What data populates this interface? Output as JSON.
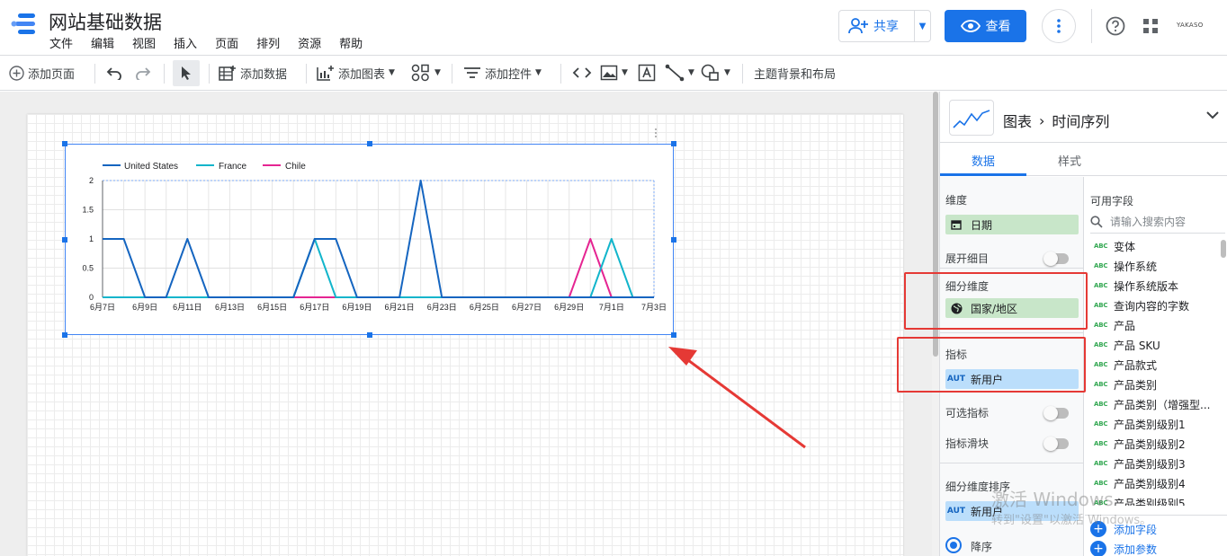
{
  "header": {
    "title": "网站基础数据",
    "menu": [
      "文件",
      "编辑",
      "视图",
      "插入",
      "页面",
      "排列",
      "资源",
      "帮助"
    ],
    "share_label": "共享",
    "view_label": "查看",
    "account_label": "YAKASO"
  },
  "toolbar": {
    "add_page": "添加页面",
    "add_data": "添加数据",
    "add_chart": "添加图表",
    "add_control": "添加控件",
    "theme_layout": "主题背景和布局"
  },
  "chart_data": {
    "type": "line",
    "categories": [
      "6月7日",
      "6月8日",
      "6月9日",
      "6月10日",
      "6月11日",
      "6月12日",
      "6月13日",
      "6月14日",
      "6月15日",
      "6月16日",
      "6月17日",
      "6月18日",
      "6月19日",
      "6月20日",
      "6月21日",
      "6月22日",
      "6月23日",
      "6月24日",
      "6月25日",
      "6月26日",
      "6月27日",
      "6月28日",
      "6月29日",
      "6月30日",
      "7月1日",
      "7月2日",
      "7月3日"
    ],
    "tick_labels": [
      "6月7日",
      "6月9日",
      "6月11日",
      "6月13日",
      "6月15日",
      "6月17日",
      "6月19日",
      "6月21日",
      "6月23日",
      "6月25日",
      "6月27日",
      "6月29日",
      "7月1日",
      "7月3日"
    ],
    "y_ticks": [
      "0",
      "0.5",
      "1",
      "1.5",
      "2"
    ],
    "ylim": [
      0,
      2
    ],
    "grid": true,
    "legend_position": "top-left",
    "series": [
      {
        "name": "United States",
        "color": "#1565c0",
        "values": [
          1,
          1,
          0,
          0,
          1,
          0,
          0,
          0,
          0,
          0,
          1,
          1,
          0,
          0,
          0,
          2,
          0,
          0,
          0,
          0,
          0,
          0,
          0,
          0,
          0,
          0,
          0
        ]
      },
      {
        "name": "France",
        "color": "#12b5cb",
        "values": [
          0,
          0,
          0,
          0,
          0,
          0,
          0,
          0,
          0,
          0,
          1,
          0,
          0,
          0,
          0,
          0,
          0,
          0,
          0,
          0,
          0,
          0,
          0,
          0,
          1,
          0,
          0
        ]
      },
      {
        "name": "Chile",
        "color": "#e52592",
        "values": [
          0,
          0,
          0,
          0,
          0,
          0,
          0,
          0,
          0,
          0,
          0,
          0,
          0,
          0,
          0,
          0,
          0,
          0,
          0,
          0,
          0,
          0,
          0,
          1,
          0,
          0,
          0
        ]
      }
    ]
  },
  "panel": {
    "crumb_chart": "图表",
    "crumb_type": "时间序列",
    "tab_data": "数据",
    "tab_style": "样式",
    "dimension_label": "维度",
    "dimension_value": "日期",
    "drilldown_label": "展开细目",
    "breakdown_label": "细分维度",
    "breakdown_value": "国家/地区",
    "metric_label": "指标",
    "metric_badge": "AUT",
    "metric_value": "新用户",
    "optional_metrics_label": "可选指标",
    "metric_slider_label": "指标滑块",
    "breakdown_sort_label": "细分维度排序",
    "sort_badge": "AUT",
    "sort_value": "新用户",
    "sort_order": "降序",
    "fields_title": "可用字段",
    "search_placeholder": "请输入搜索内容",
    "field_badge": "ABC",
    "fields": [
      "变体",
      "操作系统",
      "操作系统版本",
      "查询内容的字数",
      "产品",
      "产品 SKU",
      "产品款式",
      "产品类别",
      "产品类别（增强型...",
      "产品类别级别1",
      "产品类别级别2",
      "产品类别级别3",
      "产品类别级别4",
      "产品类别级别5"
    ],
    "add_field": "添加字段",
    "add_param": "添加参数"
  },
  "watermark": {
    "line1": "激活 Windows",
    "line2": "转到\"设置\"以激活 Windows。"
  }
}
